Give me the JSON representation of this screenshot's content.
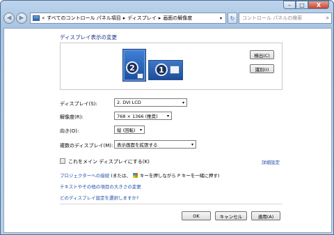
{
  "window": {
    "minimize": "–",
    "maximize": "□",
    "close": "X"
  },
  "nav": {
    "back": "◀",
    "forward": "▶",
    "breadcrumb": [
      "«",
      "すべてのコントロール パネル項目",
      "▸",
      "ディスプレイ",
      "▸",
      "画面の解像度"
    ],
    "dropdown": "▾",
    "refresh": "↻",
    "search_placeholder": "コントロール パネルの検索",
    "search_icon": "⌕"
  },
  "main": {
    "heading": "ディスプレイ表示の変更",
    "monitors": [
      {
        "number": "2",
        "selected": true
      },
      {
        "number": "1",
        "selected": false
      }
    ],
    "detect_button": "検出(C)",
    "identify_button": "識別(I)",
    "display_label": "ディスプレイ(S):",
    "display_value": "2. DVI LCD",
    "resolution_label": "解像度(R):",
    "resolution_value": "768 × 1366 (推奨)",
    "orientation_label": "向き(O):",
    "orientation_value": "縦 (回転)",
    "multi_label": "複数のディスプレイ(M):",
    "multi_value": "表示画面を拡張する",
    "main_display_checkbox": "これをメイン ディスプレイにする(K)",
    "advanced_link": "詳細設定",
    "projector_link": "プロジェクターへの接続",
    "projector_text_1": "(または、",
    "projector_text_2": "キーを押しながら P キーを一緒に押す)",
    "text_size_link": "テキストやその他の項目の大きさの変更",
    "which_settings_link": "どのディスプレイ設定を選択しますか?",
    "ok_button": "OK",
    "cancel_button": "キャンセル",
    "apply_button": "適用(A)"
  }
}
